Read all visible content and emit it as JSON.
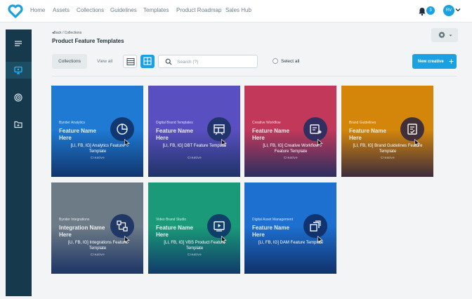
{
  "nav": {
    "items": [
      "Home",
      "Assets",
      "Collections",
      "Guidelines",
      "Templates",
      "Product Roadmap",
      "Sales Hub"
    ],
    "notification_count": "3",
    "user_initials": "RV"
  },
  "header": {
    "breadcrumb": "Back / Collections",
    "title": "Product Feature Templates"
  },
  "toolbar": {
    "tab_collections": "Collections",
    "tab_view_all": "View all",
    "search_placeholder": "Search (?)",
    "select_all": "Select all",
    "new_creative": "New creative"
  },
  "cards": [
    {
      "category": "Bynder Analytics",
      "name": "Feature Name Here",
      "title": "[LI, FB, IG] Analytics Feature Template",
      "type": "Creative",
      "color_top": "#1e7ad2",
      "color_bottom": "#11356e",
      "icon": "pie-chart-icon"
    },
    {
      "category": "Digital Brand Templates",
      "name": "Feature Name Here",
      "title": "[LI, FB, IG] DBT Feature Template",
      "type": "Creative",
      "color_top": "#5a4fc0",
      "color_bottom": "#1f3368",
      "icon": "template-layout-icon"
    },
    {
      "category": "Creative Workflow",
      "name": "Feature Name Here",
      "title": "[LI, FB, IG] Creative Workflow Feature Template",
      "type": "Creative",
      "color_top": "#c2385a",
      "color_bottom": "#2a2f60",
      "icon": "workflow-doc-icon"
    },
    {
      "category": "Brand Guidelines",
      "name": "Feature Name Here",
      "title": "[LI, FB, IG] Brand Guidelines Feature Template",
      "type": "Creative",
      "color_top": "#d4860a",
      "color_bottom": "#3b2c3c",
      "icon": "guidelines-check-icon"
    },
    {
      "category": "Bynder Integrations",
      "name": "Integration Name Here",
      "title": "[LI, FB, IG] Integrations Feature Template",
      "type": "Creative",
      "color_top": "#6d7b86",
      "color_bottom": "#1d3566",
      "icon": "integration-flow-icon"
    },
    {
      "category": "Video Brand Studio",
      "name": "Feature Name Here",
      "title": "[LI, FB, IG] VBS Product Feature Template",
      "type": "Creative",
      "color_top": "#1a9a78",
      "color_bottom": "#103b6a",
      "icon": "video-play-icon"
    },
    {
      "category": "Digital Asset Management",
      "name": "Feature Name Here",
      "title": "[LI, FB, IG] DAM Feature Template",
      "type": "",
      "color_top": "#1d6fd0",
      "color_bottom": "#10316a",
      "icon": "asset-stack-icon"
    }
  ],
  "colors": {
    "accent": "#1ba1e2",
    "sidebar": "#163a4c"
  }
}
